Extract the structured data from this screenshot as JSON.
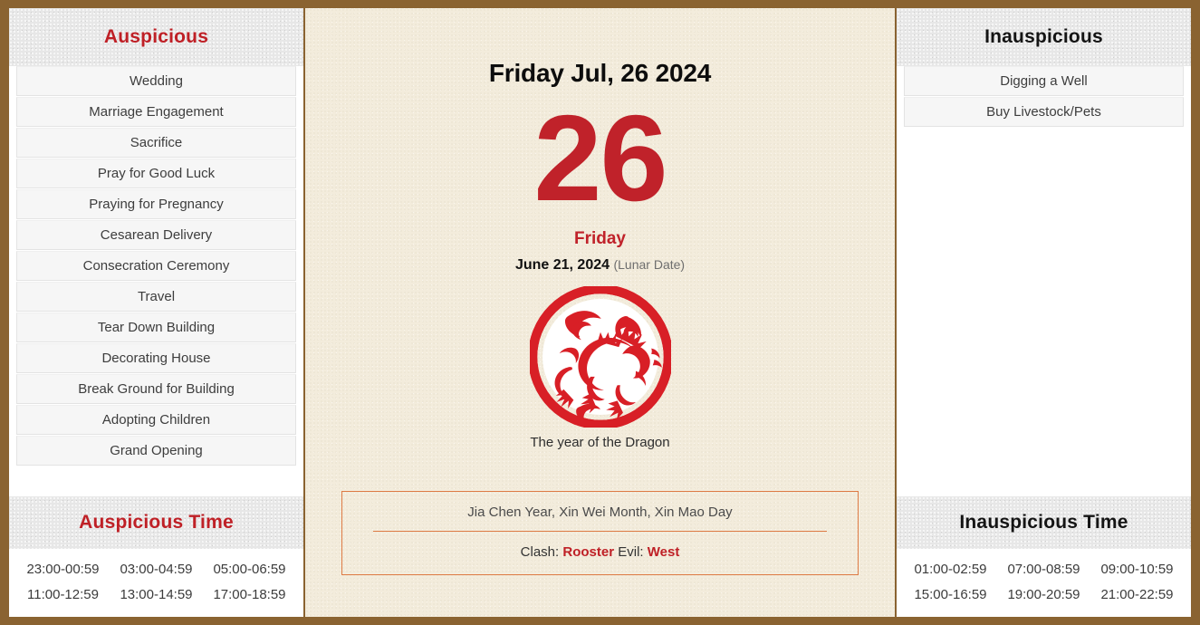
{
  "frame": {
    "border_color": "#8a6331"
  },
  "theme": {
    "accent_red": "#c0222a",
    "band_bg": "#e7e7e7",
    "center_bg": "#f3ecdc",
    "info_border": "#dd7a44"
  },
  "left_panel": {
    "header": "Auspicious",
    "items": [
      "Wedding",
      "Marriage Engagement",
      "Sacrifice",
      "Pray for Good Luck",
      "Praying for Pregnancy",
      "Cesarean Delivery",
      "Consecration Ceremony",
      "Travel",
      "Tear Down Building",
      "Decorating House",
      "Break Ground for Building",
      "Adopting Children",
      "Grand Opening"
    ],
    "time_header": "Auspicious Time",
    "times": [
      "23:00-00:59",
      "03:00-04:59",
      "05:00-06:59",
      "11:00-12:59",
      "13:00-14:59",
      "17:00-18:59"
    ]
  },
  "center_panel": {
    "date_title": "Friday Jul, 26 2024",
    "day_number": "26",
    "weekday": "Friday",
    "lunar_date": "June 21, 2024",
    "lunar_tag": "(Lunar Date)",
    "zodiac_icon": "dragon-papercut-icon",
    "zodiac_caption": "The year of the Dragon",
    "ganzhi": "Jia Chen Year, Xin Wei Month, Xin Mao Day",
    "clash_label": "Clash:",
    "clash_value": "Rooster",
    "evil_label": "Evil:",
    "evil_value": "West"
  },
  "right_panel": {
    "header": "Inauspicious",
    "items": [
      "Digging a Well",
      "Buy Livestock/Pets"
    ],
    "time_header": "Inauspicious Time",
    "times": [
      "01:00-02:59",
      "07:00-08:59",
      "09:00-10:59",
      "15:00-16:59",
      "19:00-20:59",
      "21:00-22:59"
    ]
  }
}
